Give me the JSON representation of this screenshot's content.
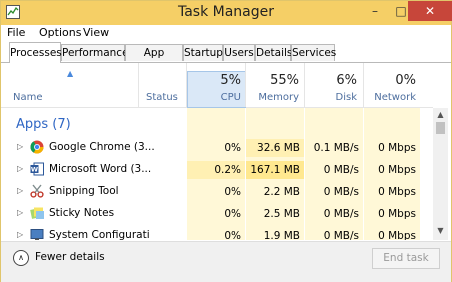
{
  "window": {
    "title": "Task Manager"
  },
  "menu": [
    {
      "label": "File"
    },
    {
      "label": "Options"
    },
    {
      "label": "View"
    }
  ],
  "tabs": [
    {
      "label": "Processes",
      "active": true
    },
    {
      "label": "Performance"
    },
    {
      "label": "App history"
    },
    {
      "label": "Startup"
    },
    {
      "label": "Users"
    },
    {
      "label": "Details"
    },
    {
      "label": "Services"
    }
  ],
  "columns": {
    "name": "Name",
    "status": "Status",
    "cpu": {
      "pct": "5%",
      "label": "CPU"
    },
    "memory": {
      "pct": "55%",
      "label": "Memory"
    },
    "disk": {
      "pct": "6%",
      "label": "Disk"
    },
    "network": {
      "pct": "0%",
      "label": "Network"
    }
  },
  "group": {
    "title": "Apps (7)"
  },
  "processes": [
    {
      "name": "Google Chrome (3...",
      "icon": "chrome-icon",
      "cpu": "0%",
      "memory": "32.6 MB",
      "disk": "0.1 MB/s",
      "network": "0 Mbps"
    },
    {
      "name": "Microsoft Word (3...",
      "icon": "word-icon",
      "cpu": "0.2%",
      "memory": "167.1 MB",
      "disk": "0 MB/s",
      "network": "0 Mbps"
    },
    {
      "name": "Snipping Tool",
      "icon": "scissors-icon",
      "cpu": "0%",
      "memory": "2.2 MB",
      "disk": "0 MB/s",
      "network": "0 Mbps"
    },
    {
      "name": "Sticky Notes",
      "icon": "sticky-notes-icon",
      "cpu": "0%",
      "memory": "2.5 MB",
      "disk": "0 MB/s",
      "network": "0 Mbps"
    },
    {
      "name": "System Configurati",
      "icon": "system-config-icon",
      "cpu": "0%",
      "memory": "1.9 MB",
      "disk": "0 MB/s",
      "network": "0 Mbps"
    }
  ],
  "footer": {
    "fewer_details": "Fewer details",
    "end_task": "End task"
  },
  "colors": {
    "titlebar": "#f5cf66",
    "close": "#c7463a",
    "heat_light": "#fff8d7",
    "heat_medium": "#fff0b3",
    "heat_strong": "#ffe88f",
    "group_title": "#2f66c4"
  }
}
